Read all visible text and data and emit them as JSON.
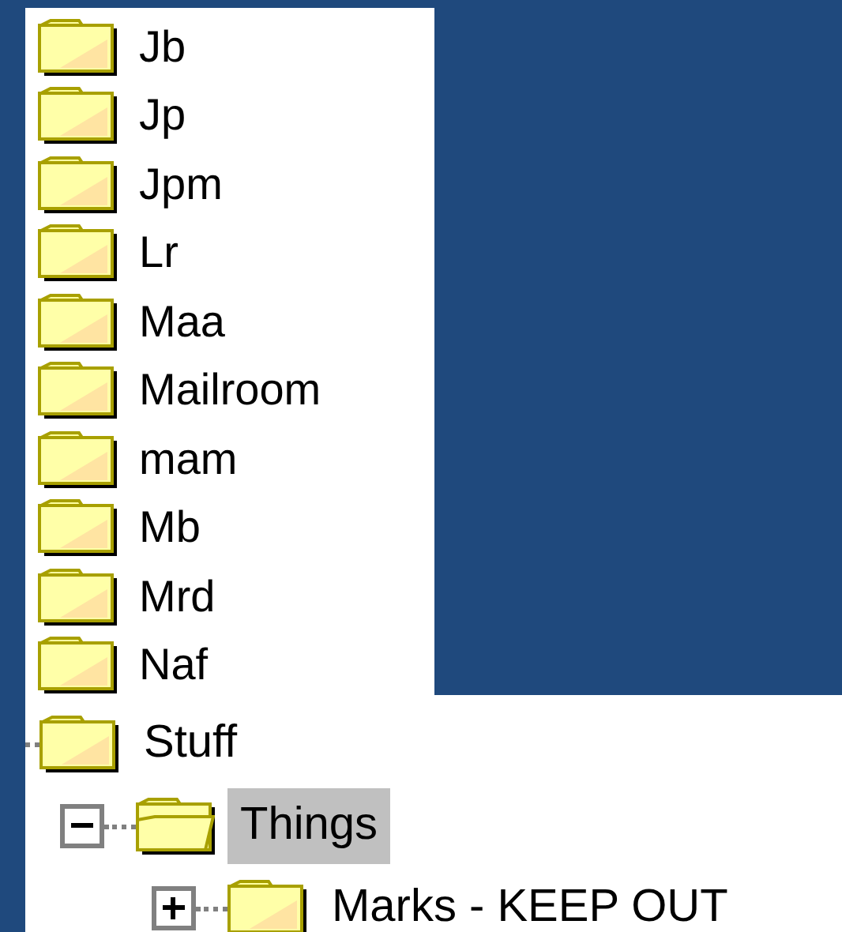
{
  "folder_list": [
    {
      "label": "Jb"
    },
    {
      "label": "Jp"
    },
    {
      "label": "Jpm"
    },
    {
      "label": "Lr"
    },
    {
      "label": "Maa"
    },
    {
      "label": "Mailroom"
    },
    {
      "label": "mam"
    },
    {
      "label": "Mb"
    },
    {
      "label": "Mrd"
    },
    {
      "label": "Naf"
    }
  ],
  "tree": [
    {
      "label": "Stuff",
      "selected": false,
      "children": [
        {
          "label": "Things",
          "selected": true,
          "expanded": true,
          "children": [
            {
              "label": "Marks - KEEP OUT",
              "selected": false,
              "expanded": false
            }
          ]
        }
      ]
    }
  ]
}
